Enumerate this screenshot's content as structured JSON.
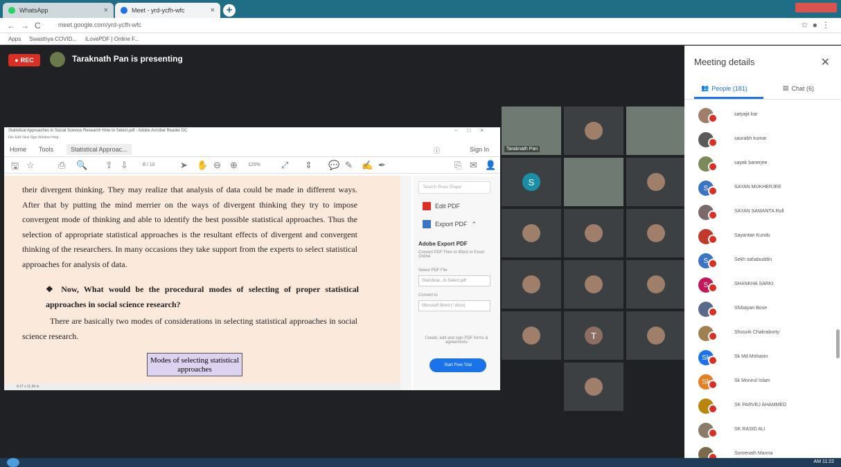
{
  "browser": {
    "tabs": [
      {
        "label": "WhatsApp"
      },
      {
        "label": "Meet - yrd-ycfh-wfc"
      }
    ],
    "url": "meet.google.com/yrd-ycfh-wfc",
    "bookmarks": [
      "Apps",
      "Swasthya COVID...",
      "iLovePDF | Online F..."
    ]
  },
  "meet": {
    "rec_label": "REC",
    "presenting_text": "Taraknath Pan is presenting",
    "tiles": [
      {
        "type": "video",
        "label": "Taraknath Pan"
      },
      {
        "type": "photo"
      },
      {
        "type": "video"
      },
      {
        "type": "initial",
        "initial": "S",
        "color": "#1a8fa5"
      },
      {
        "type": "video"
      },
      {
        "type": "photo"
      },
      {
        "type": "photo"
      },
      {
        "type": "photo"
      },
      {
        "type": "photo"
      },
      {
        "type": "photo"
      },
      {
        "type": "photo"
      },
      {
        "type": "photo"
      },
      {
        "type": "photo"
      },
      {
        "type": "initial",
        "initial": "T",
        "color": "#8d6e63"
      },
      {
        "type": "photo"
      },
      {
        "type": "photo"
      }
    ]
  },
  "acrobat": {
    "window_title": "Statistical Approaches in Social Science Research How to Select.pdf - Adobe Acrobat Reader DC",
    "menu": "File  Edit  View  Sign  Window  Help",
    "tabs": {
      "home": "Home",
      "tools": "Tools",
      "doc": "Statistical Approac...",
      "signin": "Sign In"
    },
    "page_indicator": "8 / 10",
    "zoom": "125%",
    "paragraphs": [
      "their divergent thinking. They may realize that analysis of data could be made in different ways. After that by putting the mind merrier on the ways of divergent thinking they try to impose convergent mode of thinking and able to identify the best possible statistical approaches. Thus the selection of appropriate statistical approaches is the resultant effects of divergent and convergent thinking of the researchers. In many occasions they take support from the experts to select statistical approaches for analysis of data.",
      "❖  Now, What would be the procedural modes of selecting of proper statistical approaches in social science research?",
      "There are basically two modes of considerations in selecting statistical approaches in social science research."
    ],
    "diagram_box": "Modes of selecting statistical approaches",
    "status": "8.27 x 11.69 in",
    "side": {
      "search": "Search 'Draw Shape'",
      "edit_pdf": "Edit PDF",
      "export_pdf": "Export PDF",
      "adobe_export": "Adobe Export PDF",
      "export_desc": "Convert PDF Files to Word or Excel Online",
      "select_label": "Select PDF File",
      "selected_file": "Statistical...to Select.pdf",
      "convert_label": "Convert to",
      "convert_value": "Microsoft Word (*.docx)",
      "promo": "Create, edit and sign PDF forms & agreements",
      "start_trial": "Start Free Trial"
    }
  },
  "panel": {
    "title": "Meeting details",
    "people_tab": "People (181)",
    "chat_tab": "Chat (6)",
    "people": [
      {
        "name": "satyajit kar",
        "initial": "",
        "color": "#a07f6a"
      },
      {
        "name": "saurabh kumar",
        "initial": "",
        "color": "#5a5a5a"
      },
      {
        "name": "sayak banerjee",
        "initial": "",
        "color": "#7a8a5a"
      },
      {
        "name": "SAYAN MUKHERJEE",
        "initial": "S",
        "color": "#3b74c4"
      },
      {
        "name": "SAYAN SAMANTA Roll",
        "initial": "",
        "color": "#7a6a6a"
      },
      {
        "name": "Sayantan Kundu",
        "initial": "",
        "color": "#c0392b"
      },
      {
        "name": "Sekh sahabuddin",
        "initial": "S",
        "color": "#3b74c4"
      },
      {
        "name": "SHANKHA SARKI",
        "initial": "S",
        "color": "#c2185b"
      },
      {
        "name": "Shibayan Bose",
        "initial": "",
        "color": "#5a6a8a"
      },
      {
        "name": "Shouvik Chakraborty",
        "initial": "",
        "color": "#a08050"
      },
      {
        "name": "Sk Md Mohasin",
        "initial": "Sk",
        "color": "#1a73e8"
      },
      {
        "name": "Sk Monirul Islam",
        "initial": "Sk",
        "color": "#e67e22"
      },
      {
        "name": "SK PARVEJ AHAMMED",
        "initial": "",
        "color": "#b8860b"
      },
      {
        "name": "SK RASID ALI",
        "initial": "",
        "color": "#8a7a6a"
      },
      {
        "name": "Somenath Manna",
        "initial": "",
        "color": "#7a6a4a"
      }
    ]
  },
  "taskbar": {
    "clock": "AM 11:22"
  }
}
